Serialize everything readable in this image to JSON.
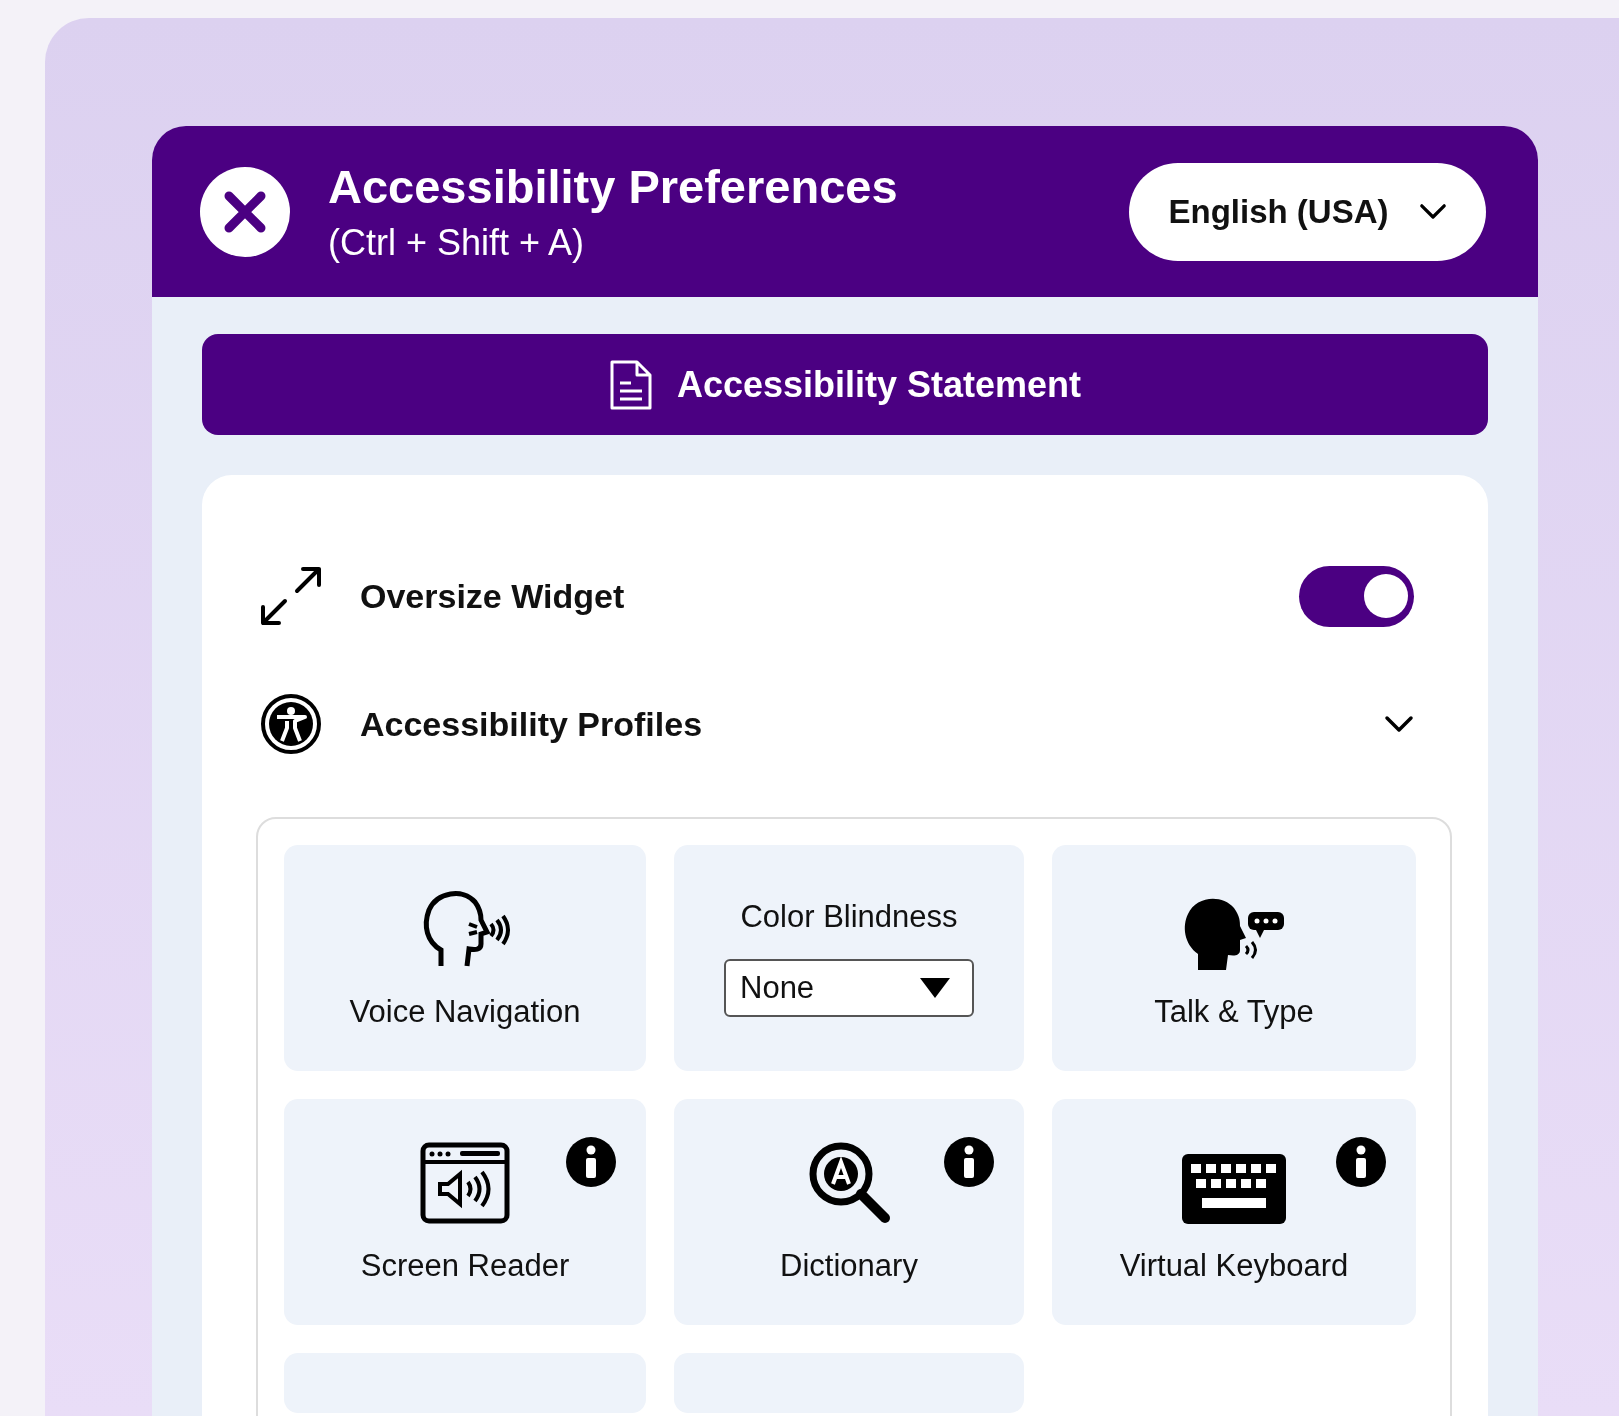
{
  "header": {
    "title": "Accessibility Preferences",
    "shortcut": "(Ctrl + Shift + A)",
    "language": "English (USA)"
  },
  "statement_button": {
    "label": "Accessibility Statement"
  },
  "settings": [
    {
      "kind": "toggle",
      "label": "Oversize Widget",
      "on": true
    },
    {
      "kind": "expander",
      "label": "Accessibility Profiles",
      "expanded": false
    }
  ],
  "tiles": [
    {
      "kind": "feature",
      "label": "Voice Navigation",
      "info": false
    },
    {
      "kind": "select",
      "label": "Color Blindness",
      "value": "None"
    },
    {
      "kind": "feature",
      "label": "Talk & Type",
      "info": false
    },
    {
      "kind": "feature",
      "label": "Screen Reader",
      "info": true
    },
    {
      "kind": "feature",
      "label": "Dictionary",
      "info": true
    },
    {
      "kind": "feature",
      "label": "Virtual Keyboard",
      "info": true
    },
    {
      "kind": "cut"
    },
    {
      "kind": "cut"
    }
  ]
}
